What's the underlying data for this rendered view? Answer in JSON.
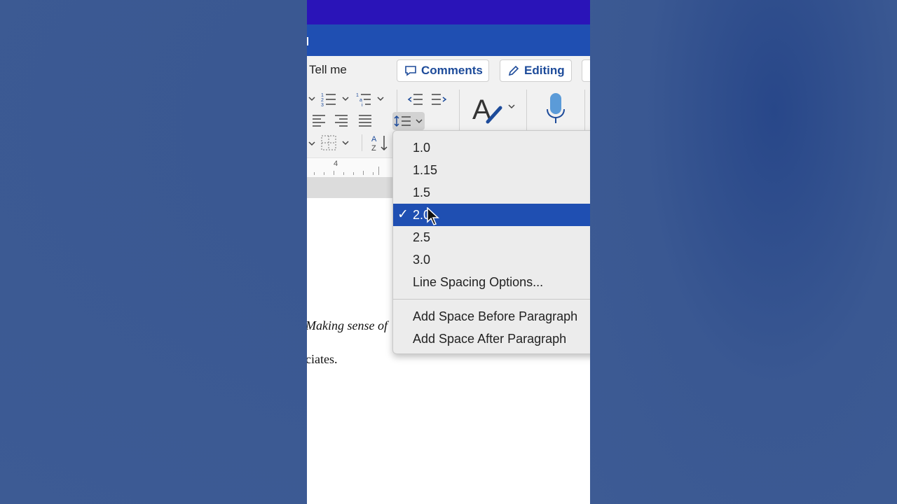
{
  "ribbon": {
    "tell_me": "Tell me",
    "comments_label": "Comments",
    "editing_label": "Editing"
  },
  "ruler": {
    "mark": "4"
  },
  "document": {
    "line1": "Making sense of",
    "line2": "ciates."
  },
  "line_spacing_menu": {
    "items": [
      {
        "label": "1.0"
      },
      {
        "label": "1.15"
      },
      {
        "label": "1.5"
      },
      {
        "label": "2.0",
        "selected": true
      },
      {
        "label": "2.5"
      },
      {
        "label": "3.0"
      },
      {
        "label": "Line Spacing Options..."
      }
    ],
    "after_separator": [
      {
        "label": "Add Space Before Paragraph"
      },
      {
        "label": "Add Space After Paragraph"
      }
    ],
    "check_mark": "✓"
  },
  "colors": {
    "title_bar": "#2a14b8",
    "ribbon_bar": "#1f4fb2",
    "selected_item": "#1f4fb2",
    "accent_text": "#1d4b9a",
    "background": "#3d5b94"
  }
}
